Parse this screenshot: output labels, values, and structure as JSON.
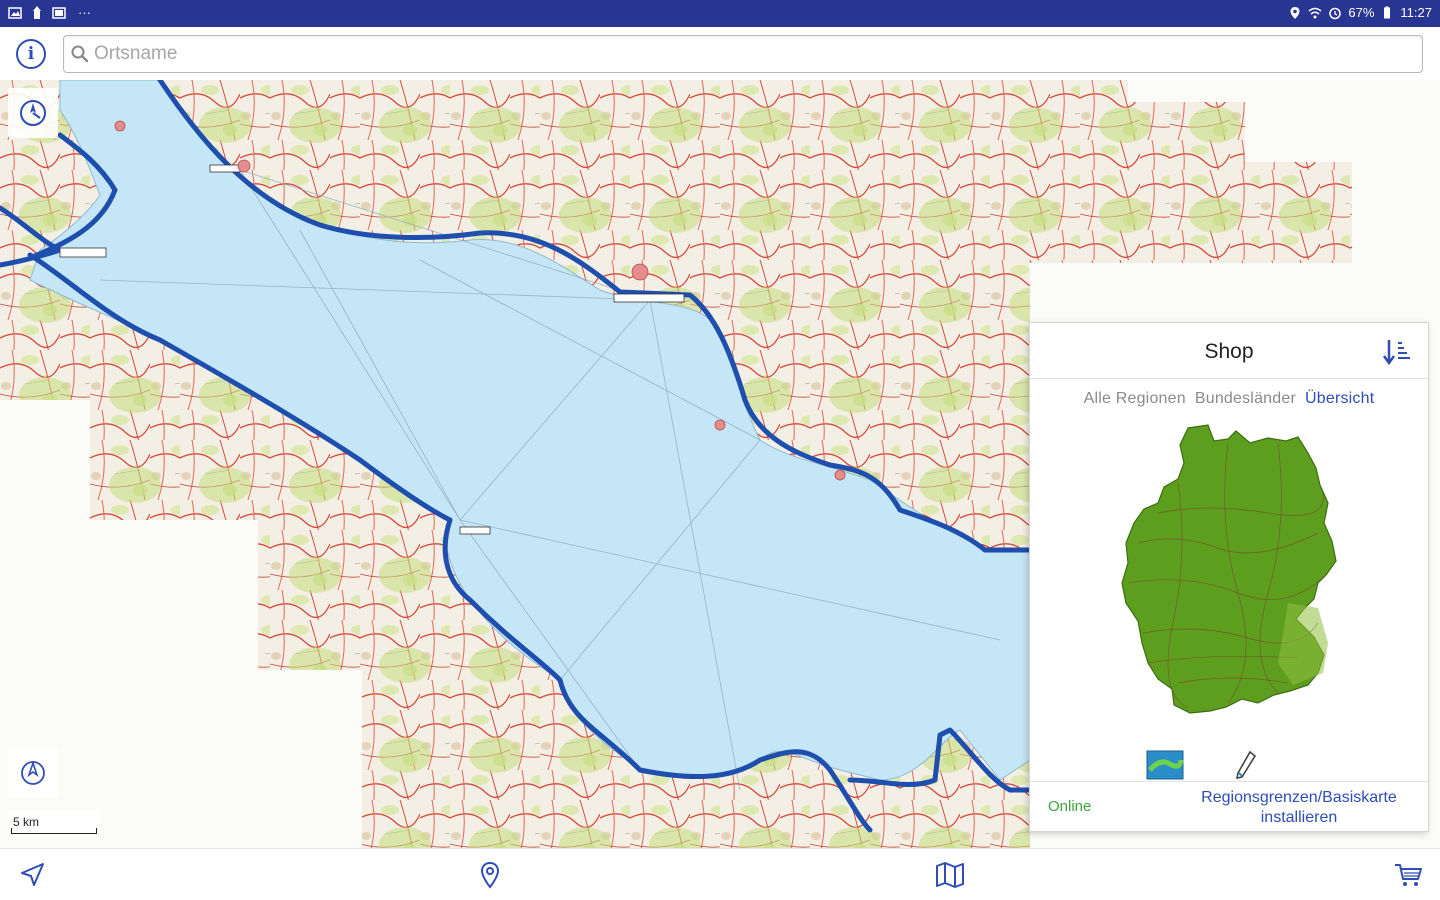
{
  "status_bar": {
    "battery": "67%",
    "time": "11:27",
    "more": "···"
  },
  "search": {
    "placeholder": "Ortsname",
    "value": ""
  },
  "map": {
    "scale_label": "5 km",
    "route_color": "#1f4fae",
    "lake_color": "#c5e6f7"
  },
  "shop": {
    "title": "Shop",
    "tabs": [
      {
        "label": "Alle Regionen",
        "active": false
      },
      {
        "label": "Bundesländer",
        "active": false
      },
      {
        "label": "Übersicht",
        "active": true
      }
    ],
    "status": "Online",
    "install_line1": "Regionsgrenzen/Basiskarte",
    "install_line2": "installieren",
    "germany_color": "#5e9e1f"
  },
  "bottom_nav": {
    "items": [
      "navigate-icon",
      "location-pin-icon",
      "map-icon",
      "cart-icon"
    ]
  },
  "colors": {
    "status_bar": "#283593",
    "accent": "#2f4db7"
  }
}
